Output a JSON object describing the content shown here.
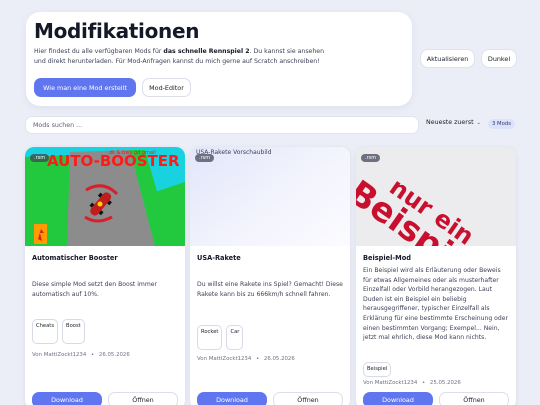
{
  "hero": {
    "title": "Modifikationen",
    "desc_a": "Hier findest du alle verfügbaren Mods für ",
    "desc_b": "das schnelle Rennspiel 2",
    "desc_c": ". Du kannst sie ansehen und direkt herunterladen. Für Mod-Anfragen kannst du mich gerne auf Scratch anschreiben!",
    "btn_create": "Wie man eine Mod erstellt",
    "btn_editor": "Mod-Editor"
  },
  "topbar": {
    "refresh": "Aktualisieren",
    "theme": "Dunkel"
  },
  "search": {
    "placeholder": "Mods suchen ..."
  },
  "sort": {
    "label": "Neueste zuerst",
    "chevron": "⌄"
  },
  "count": "3 Mods",
  "colors": {
    "accent": "#6076f0",
    "background": "#eceef7",
    "card": "#ffffff"
  },
  "cards": [
    {
      "badge": ".rsm",
      "image_text": "AUTO-BOOSTER",
      "image_caption": "dk & bwy gd gmail",
      "title": "Automatischer Booster",
      "desc": "Diese simple Mod setzt den Boost immer automatisch auf 10%.",
      "tags": [
        "Cheats",
        "Boost"
      ],
      "author": "Von MattiZockt1234",
      "sep": "•",
      "date": "26.05.2026",
      "download": "Download",
      "open": "Öffnen"
    },
    {
      "badge": ".rsm",
      "image_alt": "USA-Rakete Vorschaubild",
      "title": "USA-Rakete",
      "desc": "Du willst eine Rakete ins Spiel? Gemacht! Diese Rakete kann bis zu 666km/h schnell fahren.",
      "tags": [
        "Rocket",
        "Car"
      ],
      "author": "Von MattiZockt1234",
      "sep": "•",
      "date": "26.05.2026",
      "download": "Download",
      "open": "Öffnen"
    },
    {
      "badge": ".rsm",
      "image_text": "nur ein Beispiel",
      "title": "Beispiel-Mod",
      "desc": "Ein Beispiel wird als Erläuterung oder Beweis für etwas Allgemeines oder als musterhafter Einzelfall oder Vorbild herangezogen. Laut Duden ist ein Beispiel ein beliebig herausgegriffener, typischer Einzelfall als Erklärung für eine bestimmte Erscheinung oder einen bestimmten Vorgang; Exempel... Nein, jetzt mal ehrlich, diese Mod kann nichts.",
      "tags": [
        "Beispiel"
      ],
      "author": "Von MattiZockt1234",
      "sep": "•",
      "date": "25.05.2026",
      "download": "Download",
      "open": "Öffnen"
    }
  ]
}
